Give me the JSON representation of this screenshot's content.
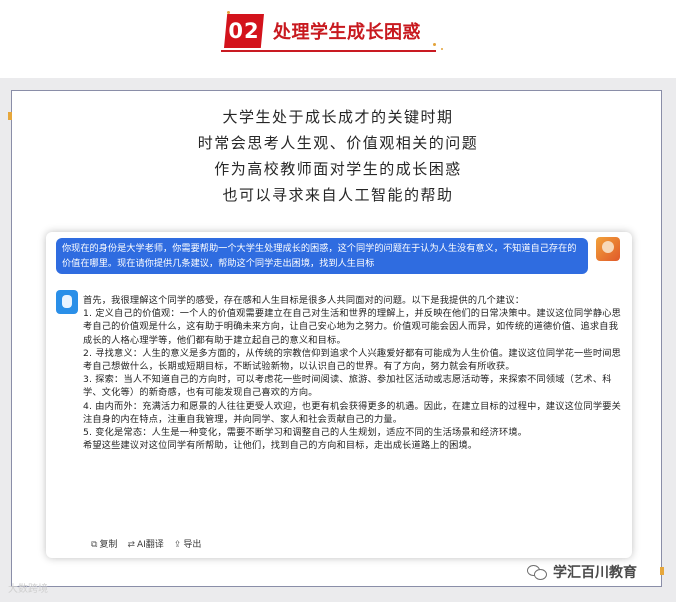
{
  "header": {
    "number": "02",
    "title": "处理学生成长困惑"
  },
  "intro": [
    "大学生处于成长成才的关键时期",
    "时常会思考人生观、价值观相关的问题",
    "作为高校教师面对学生的成长困惑",
    "也可以寻求来自人工智能的帮助"
  ],
  "chat": {
    "user_message": "你现在的身份是大学老师，你需要帮助一个大学生处理成长的困惑，这个同学的问题在于认为人生没有意义，不知道自己存在的价值在哪里。现在请你提供几条建议，帮助这个同学走出困境，找到人生目标",
    "bot_message": [
      "首先，我很理解这个同学的感受，存在感和人生目标是很多人共同面对的问题。以下是我提供的几个建议：",
      "1. 定义自己的价值观：一个人的价值观需要建立在自己对生活和世界的理解上，并反映在他们的日常决策中。建议这位同学静心思考自己的价值观是什么，这有助于明确未来方向，让自己安心地为之努力。价值观可能会因人而异，如传统的道德价值、追求自我成长的人格心理学等，他们都有助于建立起自己的意义和目标。",
      "2. 寻找意义：人生的意义是多方面的，从传统的宗教信仰到追求个人兴趣爱好都有可能成为人生价值。建议这位同学花一些时间思考自己想做什么，长期或短期目标，不断试验新物，以认识自己的世界。有了方向，努力就会有所收获。",
      "3. 探索：当人不知道自己的方向时，可以考虑花一些时间阅读、旅游、参加社区活动或志愿活动等，来探索不同领域（艺术、科学、文化等）的新奇感，也有可能发现自己喜欢的方向。",
      "4. 由内而外：充满活力和愿景的人往往更受人欢迎，也更有机会获得更多的机遇。因此，在建立目标的过程中，建议这位同学要关注自身的内在特点，注重自我管理，并向同学、家人和社会贡献自己的力量。",
      "5. 变化是常态：人生是一种变化，需要不断学习和调整自己的人生规划，适应不同的生活场景和经济环境。",
      "希望这些建议对这位同学有所帮助，让他们，找到自己的方向和目标，走出成长道路上的困境。"
    ],
    "actions": {
      "copy": "复制",
      "translate": "AI翻译",
      "export": "导出"
    }
  },
  "watermark_left": "大数跨境",
  "watermark_right": "学汇百川教育",
  "colors": {
    "accent_red": "#d3131c",
    "user_bubble": "#2f6ce0",
    "panel_bg": "#ebebed"
  }
}
